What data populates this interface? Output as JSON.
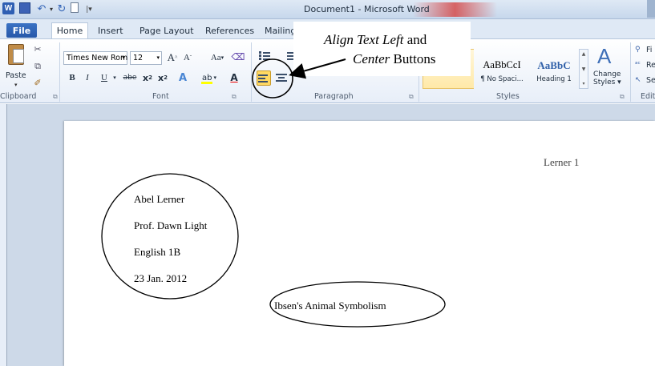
{
  "window": {
    "title": "Document1 - Microsoft Word",
    "app_icon": "W"
  },
  "quick_access": {
    "icons": [
      "word-logo-icon",
      "save-icon",
      "undo-icon",
      "redo-icon",
      "new-document-icon",
      "customize-icon"
    ]
  },
  "tabs": [
    {
      "label": "File"
    },
    {
      "label": "Home",
      "active": true
    },
    {
      "label": "Insert"
    },
    {
      "label": "Page Layout"
    },
    {
      "label": "References"
    },
    {
      "label": "Mailing"
    }
  ],
  "ribbon": {
    "clipboard": {
      "paste_label": "Paste",
      "group_label": "Clipboard"
    },
    "font": {
      "font_name": "Times New Rom",
      "font_size": "12",
      "grow_label": "A",
      "shrink_label": "A",
      "change_case_label": "Aa",
      "bold": "B",
      "italic": "I",
      "underline": "U",
      "strikethrough": "abe",
      "subscript": "x",
      "superscript": "x",
      "text_effects": "A",
      "highlight": "ab",
      "font_color": "A",
      "group_label": "Font"
    },
    "paragraph": {
      "group_label": "Paragraph"
    },
    "styles": {
      "tiles": [
        {
          "preview": "",
          "name": ""
        },
        {
          "preview": "AaBbCcI",
          "name": "¶ No Spaci..."
        },
        {
          "preview": "AaBbC",
          "name": "Heading 1"
        }
      ],
      "change_styles_label_1": "Change",
      "change_styles_label_2": "Styles",
      "group_label": "Styles"
    },
    "editing": {
      "find": "Fi",
      "replace": "Re",
      "select": "Se",
      "group_label": "Edit"
    }
  },
  "annotation": {
    "line1_italic": "Align Text Left",
    "line1_rest": " and",
    "line2_italic": "Center",
    "line2_rest": " Buttons"
  },
  "document": {
    "header": "Lerner 1",
    "heading_lines": [
      "Abel Lerner",
      "Prof. Dawn Light",
      "English 1B",
      "23 Jan. 2012"
    ],
    "title": "Ibsen's Animal Symbolism"
  },
  "colors": {
    "accent_file_tab": "#2b5fae",
    "selected_button": "#ffd862",
    "workspace": "#cdd9e8"
  }
}
